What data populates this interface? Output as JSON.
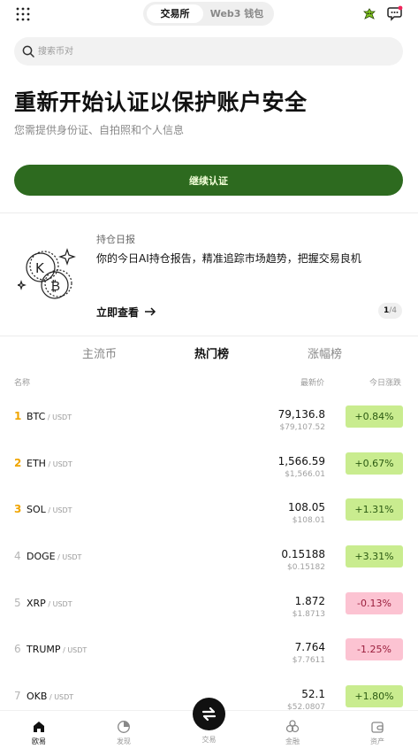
{
  "header": {
    "tabs": [
      {
        "label": "交易所",
        "active": true
      },
      {
        "label": "Web3 钱包",
        "active": false
      }
    ]
  },
  "search": {
    "placeholder": "搜索币对"
  },
  "verify": {
    "title": "重新开始认证以保护账户安全",
    "subtitle": "您需提供身份证、自拍照和个人信息",
    "button": "继续认证"
  },
  "report": {
    "tag": "持仓日报",
    "text": "你的今日AI持仓报告，精准追踪市场趋势，把握交易良机",
    "link": "立即查看",
    "pager_current": "1",
    "pager_total": "/4"
  },
  "market_tabs": [
    "主流币",
    "热门榜",
    "涨幅榜"
  ],
  "columns": {
    "name": "名称",
    "price": "最新价",
    "change": "今日涨跌"
  },
  "rows": [
    {
      "rank": "1",
      "base": "BTC",
      "quote": " / USDT",
      "price": "79,136.8",
      "usd": "$79,107.52",
      "change": "+0.84%",
      "dir": "up"
    },
    {
      "rank": "2",
      "base": "ETH",
      "quote": " / USDT",
      "price": "1,566.59",
      "usd": "$1,566.01",
      "change": "+0.67%",
      "dir": "up"
    },
    {
      "rank": "3",
      "base": "SOL",
      "quote": " / USDT",
      "price": "108.05",
      "usd": "$108.01",
      "change": "+1.31%",
      "dir": "up"
    },
    {
      "rank": "4",
      "base": "DOGE",
      "quote": " / USDT",
      "price": "0.15188",
      "usd": "$0.15182",
      "change": "+3.31%",
      "dir": "up"
    },
    {
      "rank": "5",
      "base": "XRP",
      "quote": " / USDT",
      "price": "1.872",
      "usd": "$1.8713",
      "change": "-0.13%",
      "dir": "down"
    },
    {
      "rank": "6",
      "base": "TRUMP",
      "quote": " / USDT",
      "price": "7.764",
      "usd": "$7.7611",
      "change": "-1.25%",
      "dir": "down"
    },
    {
      "rank": "7",
      "base": "OKB",
      "quote": " / USDT",
      "price": "52.1",
      "usd": "$52.0807",
      "change": "+1.80%",
      "dir": "up"
    }
  ],
  "nav": {
    "home": "欧易",
    "discover": "发现",
    "trade": "交易",
    "earn": "金融",
    "assets": "资产"
  },
  "colors": {
    "accent": "#2d6a1f",
    "up_bg": "#c9ec8f",
    "down_bg": "#fcc3d2",
    "rank_top": "#f0a500"
  }
}
